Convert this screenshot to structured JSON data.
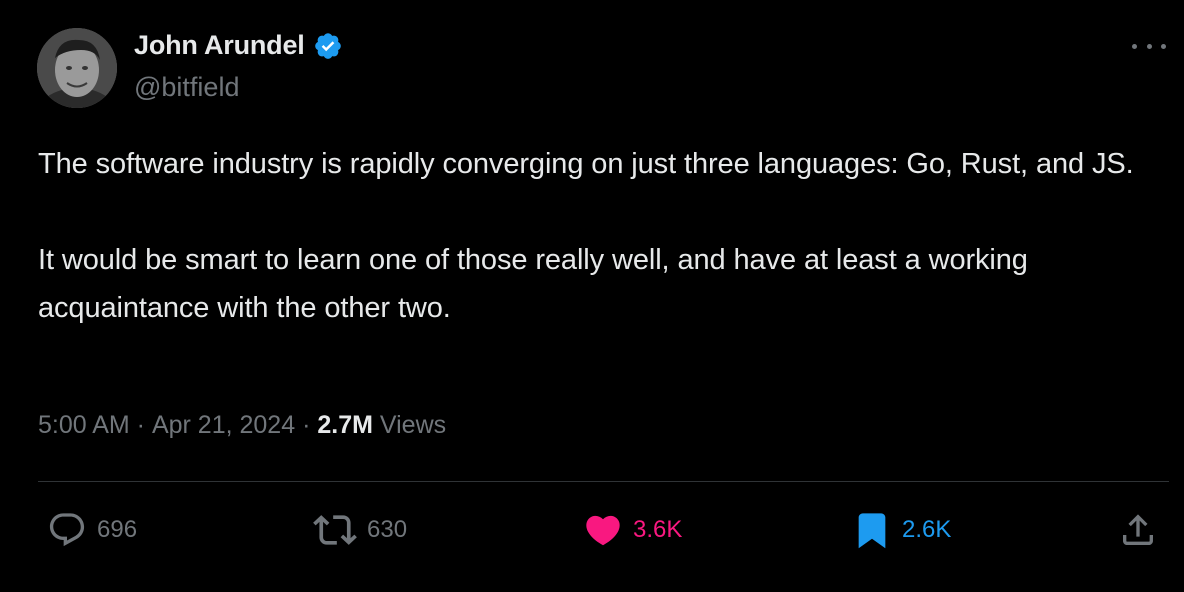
{
  "author": {
    "display_name": "John Arundel",
    "handle": "@bitfield",
    "verified": true
  },
  "tweet": {
    "paragraphs": [
      "The software industry is rapidly converging on just three languages: Go, Rust, and JS.",
      "It would be smart to learn one of those really well, and have at least a working acquaintance with the other two."
    ]
  },
  "meta": {
    "time": "5:00 AM",
    "separator": " · ",
    "date": "Apr 21, 2024",
    "views_count": "2.7M",
    "views_label": " Views"
  },
  "actions": {
    "replies": "696",
    "reposts": "630",
    "likes": "3.6K",
    "bookmarks": "2.6K"
  },
  "colors": {
    "background": "#000000",
    "text": "#e7e9ea",
    "muted": "#71767b",
    "verified_blue": "#1d9bf0",
    "like_pink": "#f91880",
    "bookmark_blue": "#1d9bf0"
  },
  "icons": {
    "more": "more-dots-icon",
    "reply": "reply-icon",
    "repost": "repost-icon",
    "like": "heart-icon",
    "bookmark": "bookmark-icon",
    "share": "share-icon",
    "verified": "verified-badge-icon"
  }
}
